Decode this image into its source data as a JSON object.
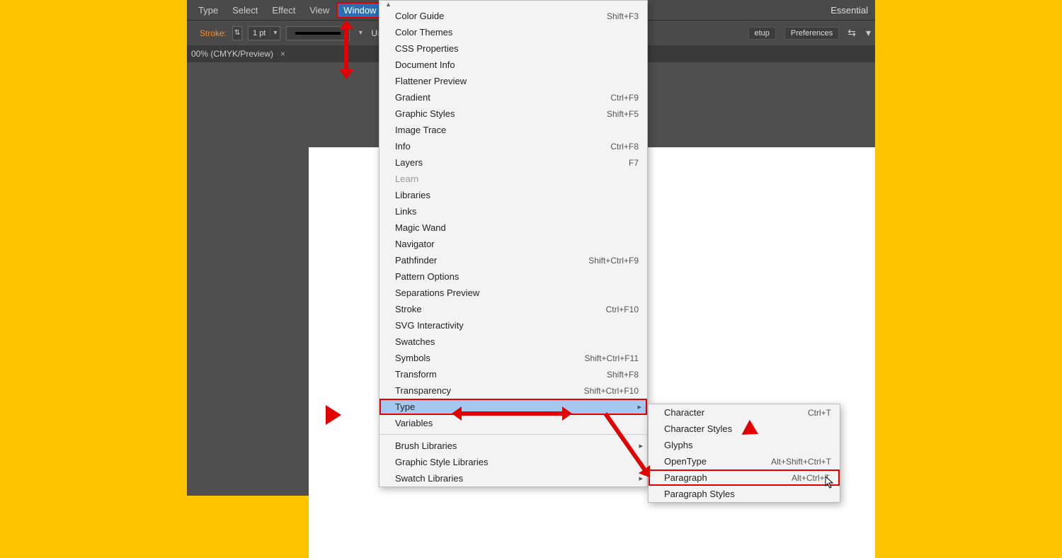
{
  "menubar": {
    "items": [
      "Type",
      "Select",
      "Effect",
      "View",
      "Window"
    ],
    "active_index": 4,
    "workspace": "Essential"
  },
  "toolbar": {
    "stroke_label": "Stroke:",
    "stroke_value": "1 pt",
    "uniform_label": "Uniform",
    "setup_btn": "etup",
    "prefs_btn": "Preferences"
  },
  "doc_tab": {
    "label": "00% (CMYK/Preview)"
  },
  "window_menu": {
    "scroll_indicator": "▲",
    "items": [
      {
        "label": "Color Guide",
        "shortcut": "Shift+F3"
      },
      {
        "label": "Color Themes",
        "shortcut": ""
      },
      {
        "label": "CSS Properties",
        "shortcut": ""
      },
      {
        "label": "Document Info",
        "shortcut": ""
      },
      {
        "label": "Flattener Preview",
        "shortcut": ""
      },
      {
        "label": "Gradient",
        "shortcut": "Ctrl+F9"
      },
      {
        "label": "Graphic Styles",
        "shortcut": "Shift+F5"
      },
      {
        "label": "Image Trace",
        "shortcut": ""
      },
      {
        "label": "Info",
        "shortcut": "Ctrl+F8"
      },
      {
        "label": "Layers",
        "shortcut": "F7"
      },
      {
        "label": "Learn",
        "shortcut": "",
        "disabled": true
      },
      {
        "label": "Libraries",
        "shortcut": ""
      },
      {
        "label": "Links",
        "shortcut": ""
      },
      {
        "label": "Magic Wand",
        "shortcut": ""
      },
      {
        "label": "Navigator",
        "shortcut": ""
      },
      {
        "label": "Pathfinder",
        "shortcut": "Shift+Ctrl+F9"
      },
      {
        "label": "Pattern Options",
        "shortcut": ""
      },
      {
        "label": "Separations Preview",
        "shortcut": ""
      },
      {
        "label": "Stroke",
        "shortcut": "Ctrl+F10"
      },
      {
        "label": "SVG Interactivity",
        "shortcut": ""
      },
      {
        "label": "Swatches",
        "shortcut": ""
      },
      {
        "label": "Symbols",
        "shortcut": "Shift+Ctrl+F11"
      },
      {
        "label": "Transform",
        "shortcut": "Shift+F8"
      },
      {
        "label": "Transparency",
        "shortcut": "Shift+Ctrl+F10"
      },
      {
        "label": "Type",
        "shortcut": "",
        "sub": true,
        "highlight": true
      },
      {
        "label": "Variables",
        "shortcut": ""
      }
    ],
    "footer_items": [
      {
        "label": "Brush Libraries",
        "sub": true
      },
      {
        "label": "Graphic Style Libraries",
        "sub": true
      },
      {
        "label": "Swatch Libraries",
        "sub": true
      }
    ]
  },
  "type_submenu": {
    "items": [
      {
        "label": "Character",
        "shortcut": "Ctrl+T"
      },
      {
        "label": "Character Styles",
        "shortcut": ""
      },
      {
        "label": "Glyphs",
        "shortcut": ""
      },
      {
        "label": "OpenType",
        "shortcut": "Alt+Shift+Ctrl+T"
      },
      {
        "label": "Paragraph",
        "shortcut": "Alt+Ctrl+T",
        "highlight": true
      },
      {
        "label": "Paragraph Styles",
        "shortcut": ""
      }
    ]
  }
}
